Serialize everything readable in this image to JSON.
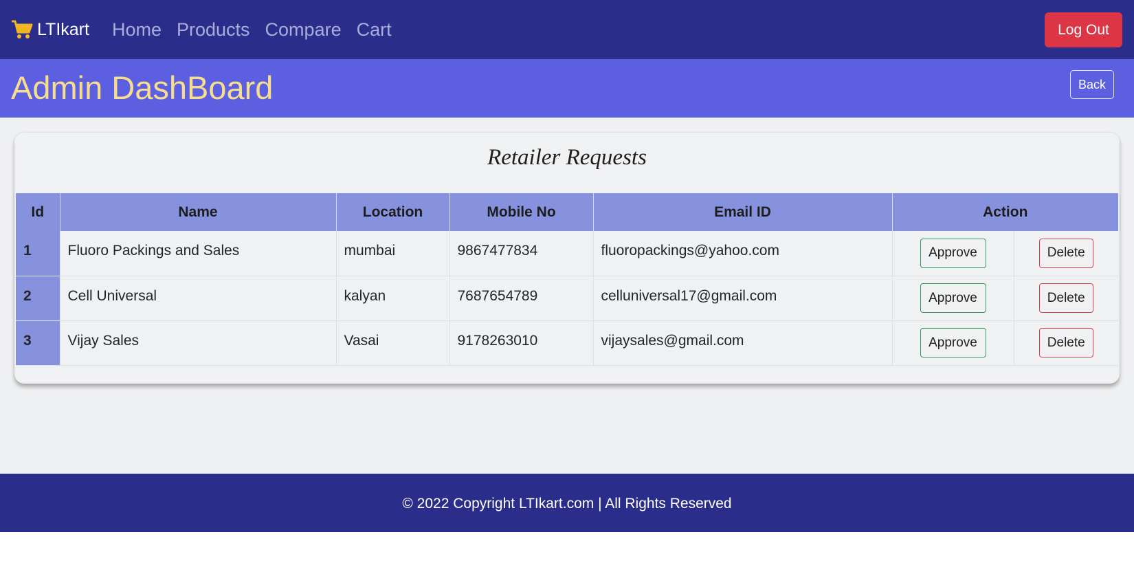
{
  "navbar": {
    "brand": "LTIkart",
    "brand_icon": "shopping-cart-icon",
    "brand_icon_color": "#f2b623",
    "links": [
      "Home",
      "Products",
      "Compare",
      "Cart"
    ],
    "logout_label": "Log Out"
  },
  "header": {
    "title": "Admin DashBoard",
    "back_label": "Back"
  },
  "card": {
    "title": "Retailer Requests",
    "columns": [
      "Id",
      "Name",
      "Location",
      "Mobile No",
      "Email ID",
      "Action"
    ],
    "rows": [
      {
        "id": "1",
        "name": "Fluoro Packings and Sales",
        "location": "mumbai",
        "mobile": "9867477834",
        "email": "fluoropackings@yahoo.com",
        "approve": "Approve",
        "delete": "Delete"
      },
      {
        "id": "2",
        "name": "Cell Universal",
        "location": "kalyan",
        "mobile": "7687654789",
        "email": "celluniversal17@gmail.com",
        "approve": "Approve",
        "delete": "Delete"
      },
      {
        "id": "3",
        "name": "Vijay Sales",
        "location": "Vasai",
        "mobile": "9178263010",
        "email": "vijaysales@gmail.com",
        "approve": "Approve",
        "delete": "Delete"
      }
    ]
  },
  "footer": {
    "text": "© 2022 Copyright LTIkart.com | All Rights Reserved"
  },
  "colors": {
    "navbar_bg": "#2b2d8a",
    "header_bg": "#5b5fe0",
    "title_color": "#f6de8d",
    "table_header_bg": "#8792df",
    "logout_bg": "#dc3545",
    "approve_border": "#2e9a5a",
    "delete_border": "#d9414f"
  }
}
